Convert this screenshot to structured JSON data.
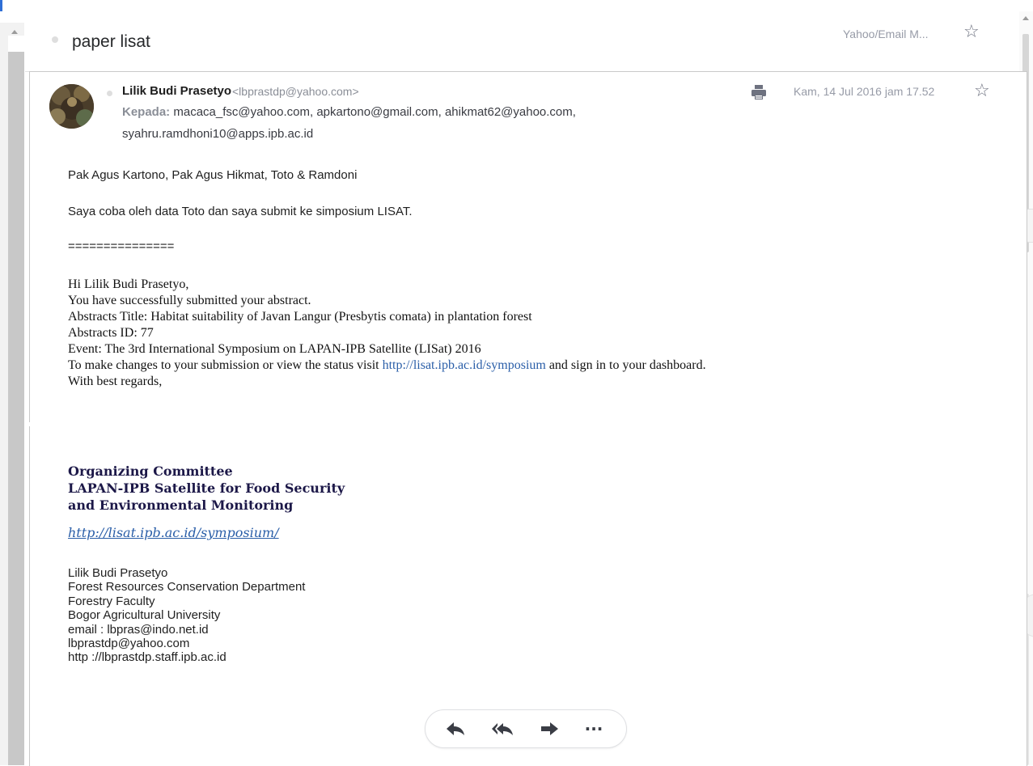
{
  "thread": {
    "subject": "paper lisat",
    "folder": "Yahoo/Email M..."
  },
  "message": {
    "sender_name": "Lilik Budi Prasetyo",
    "sender_email": "<lbprastdp@yahoo.com>",
    "to_label": "Kepada:",
    "to_line1": " macaca_fsc@yahoo.com,  apkartono@gmail.com,  ahikmat62@yahoo.com,",
    "to_line2": "syahru.ramdhoni10@apps.ipb.ac.id",
    "date": "Kam, 14 Jul 2016 jam 17.52"
  },
  "body": {
    "greeting": "Pak Agus Kartono, Pak Agus Hikmat, Toto & Ramdoni",
    "intro": "Saya coba oleh data Toto dan saya submit ke simposium LISAT.",
    "separator": "===============",
    "fwd_line1": "Hi Lilik Budi Prasetyo,",
    "fwd_line2": "You have successfully submitted your abstract.",
    "fwd_line3": "Abstracts Title: Habitat suitability of Javan Langur (Presbytis comata) in plantation forest",
    "fwd_line4": "Abstracts ID: 77",
    "fwd_line5": "Event: The 3rd International Symposium on LAPAN-IPB Satellite (LISat) 2016",
    "fwd_line6_pre": "To make changes to your submission or view the status visit ",
    "fwd_line6_link": "http://lisat.ipb.ac.id/symposium",
    "fwd_line6_post": " and sign in to your dashboard.",
    "fwd_line7": "With best regards,"
  },
  "org": {
    "line1": "Organizing Committee",
    "line2": "LAPAN-IPB Satellite for Food Security",
    "line3": "and Environmental Monitoring",
    "link": "http://lisat.ipb.ac.id/symposium/"
  },
  "signature": {
    "name": "Lilik Budi Prasetyo",
    "dept": "Forest Resources Conservation Department",
    "faculty": "Forestry Faculty",
    "university": "Bogor Agricultural University",
    "email1": "email : lbpras@indo.net.id",
    "email2": "lbprastdp@yahoo.com",
    "web": "http ://lbprastdp.staff.ipb.ac.id"
  },
  "actions": {
    "more_label": "···"
  },
  "icons": {
    "star": "star-outline-icon",
    "print": "print-icon",
    "reply": "reply-icon",
    "reply_all": "reply-all-icon",
    "forward": "forward-icon",
    "more": "more-icon"
  },
  "colors": {
    "link": "#2a5ea8",
    "org_text": "#1c1848",
    "muted": "#8a8e97"
  }
}
